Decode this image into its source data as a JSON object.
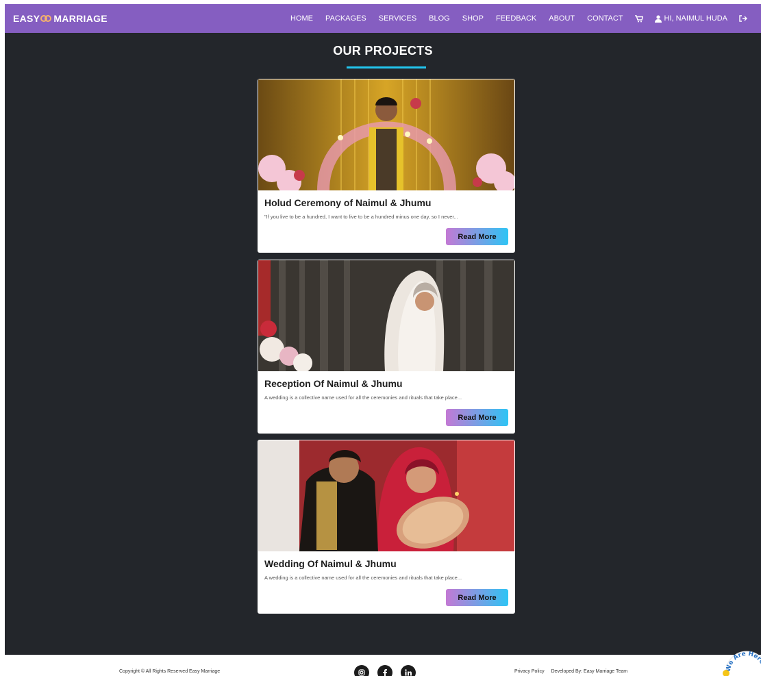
{
  "navbar": {
    "brand_left": "EASY",
    "brand_right": "MARRIAGE",
    "links": [
      "HOME",
      "PACKAGES",
      "SERVICES",
      "BLOG",
      "SHOP",
      "FEEDBACK",
      "ABOUT",
      "CONTACT"
    ],
    "cart_icon": "cart-icon",
    "user_label": "HI, NAIMUL HUDA",
    "user_icon": "user-icon",
    "logout_icon": "logout-icon"
  },
  "main": {
    "title": "OUR PROJECTS",
    "projects": [
      {
        "title": "Holud Ceremony of Naimul & Jhumu",
        "text": "\"If you live to be a hundred, I want to live to be a hundred minus one day, so I never...",
        "button": "Read More"
      },
      {
        "title": "Reception Of Naimul & Jhumu",
        "text": "A wedding is a collective name used for all the ceremonies and rituals that take place...",
        "button": "Read More"
      },
      {
        "title": "Wedding Of Naimul & Jhumu",
        "text": "A wedding is a collective name used for all the ceremonies and rituals that take place...",
        "button": "Read More"
      }
    ]
  },
  "footer": {
    "copyright": "Copyright © All Rights Reserved Easy Marriage",
    "social_icons": [
      "instagram-icon",
      "facebook-icon",
      "linkedin-icon"
    ],
    "privacy": "Privacy Policy",
    "developed": "Developed By: Easy Marriage Team",
    "badge_text": "We Are Here"
  },
  "colors": {
    "navbar": "#855ec1",
    "background": "#23262b",
    "accent_underline": "#22c6f0",
    "button_gradient_start": "#c379d4",
    "button_gradient_end": "#2ec4f4"
  }
}
